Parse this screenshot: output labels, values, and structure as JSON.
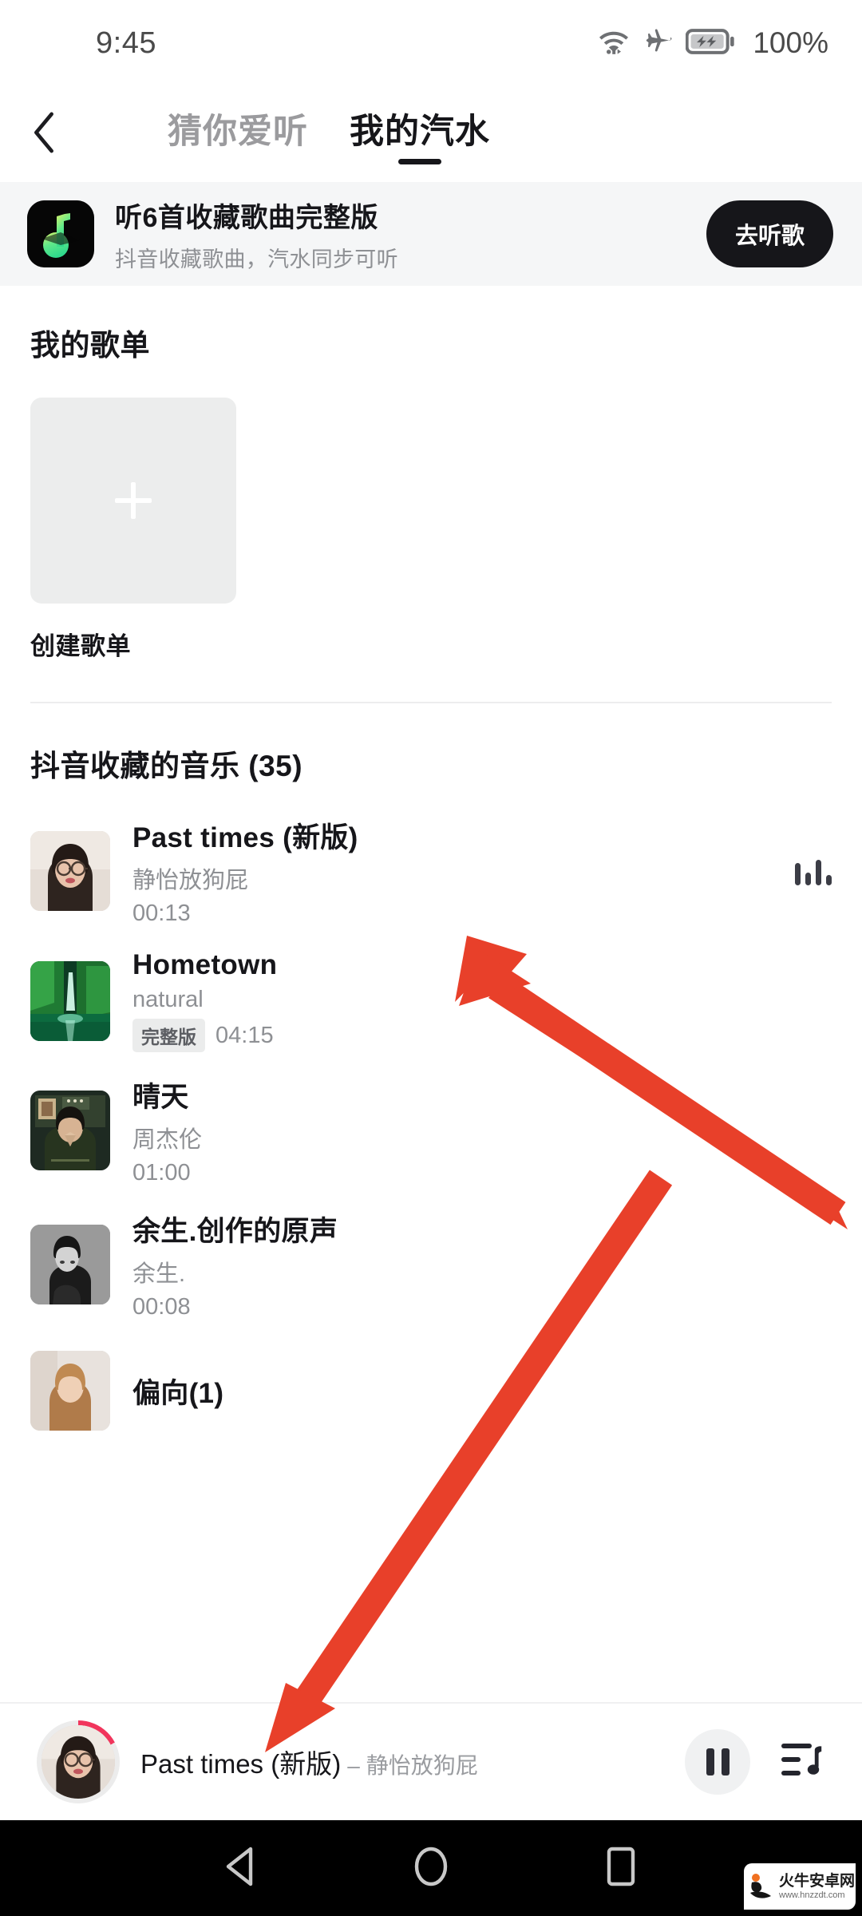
{
  "status_bar": {
    "time": "9:45",
    "battery_percent": "100%",
    "icons": [
      "wifi-icon",
      "airplane-mode-icon",
      "battery-charging-icon"
    ]
  },
  "header": {
    "back_icon": "chevron-left-icon",
    "tabs": [
      {
        "label": "猜你爱听",
        "active": false
      },
      {
        "label": "我的汽水",
        "active": true
      }
    ]
  },
  "banner": {
    "icon": "soda-music-app-icon",
    "title": "听6首收藏歌曲完整版",
    "subtitle": "抖音收藏歌曲，汽水同步可听",
    "button_label": "去听歌"
  },
  "playlists_section": {
    "title": "我的歌单",
    "create_card": {
      "icon": "plus-icon",
      "label": "创建歌单"
    }
  },
  "songs_section": {
    "title": "抖音收藏的音乐 (35)",
    "items": [
      {
        "title": "Past times (新版)",
        "artist": "静怡放狗屁",
        "duration": "00:13",
        "badge": "",
        "playing": true,
        "art": "portrait-girl-glasses"
      },
      {
        "title": "Hometown",
        "artist": "natural",
        "duration": "04:15",
        "badge": "完整版",
        "playing": false,
        "art": "green-waterfall"
      },
      {
        "title": "晴天",
        "artist": "周杰伦",
        "duration": "01:00",
        "badge": "",
        "playing": false,
        "art": "jay-chou-album"
      },
      {
        "title": "余生.创作的原声",
        "artist": "余生.",
        "duration": "00:08",
        "badge": "",
        "playing": false,
        "art": "bw-man-portrait"
      },
      {
        "title": "偏向(1)",
        "artist": "",
        "duration": "",
        "badge": "",
        "playing": false,
        "art": "blonde-girl"
      }
    ]
  },
  "player": {
    "avatar": "now-playing-avatar",
    "title": "Past times (新版)",
    "separator": "–",
    "artist": "静怡放狗屁",
    "play_state_icon": "pause-icon",
    "queue_icon": "playlist-queue-icon",
    "progress_percent": 17
  },
  "nav_bar": {
    "back_icon": "nav-back-triangle-icon",
    "home_icon": "nav-home-circle-icon",
    "recents_icon": "nav-recents-square-icon"
  },
  "watermark": {
    "name": "火牛安卓网",
    "url": "www.hnzzdt.com"
  },
  "colors": {
    "accent_green": "#4ee27a",
    "arrow_red": "#e8402a",
    "progress_pink": "#f1355c",
    "text_primary": "#16161a",
    "text_secondary": "#8e9094"
  }
}
